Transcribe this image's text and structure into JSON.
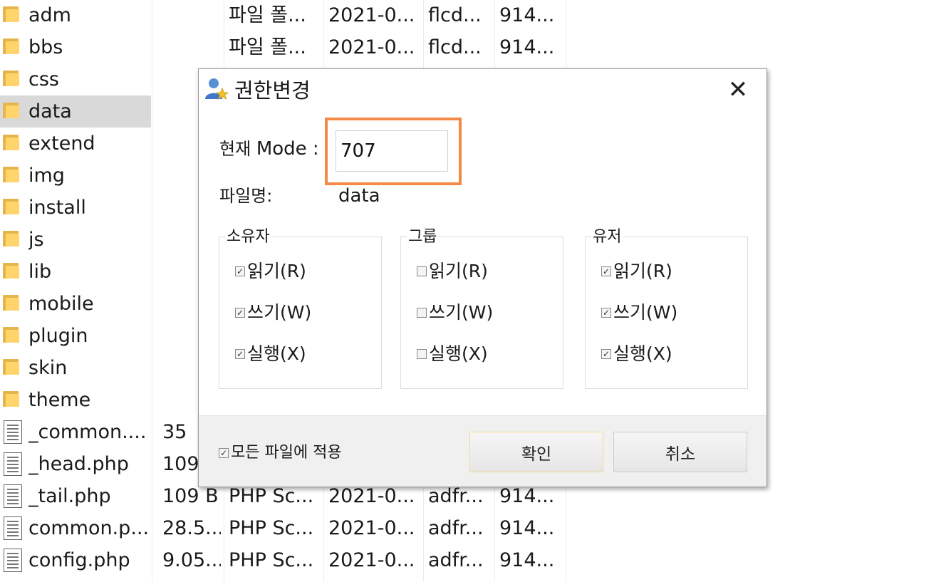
{
  "files": [
    {
      "kind": "folder",
      "name": "adm",
      "size": "",
      "type": "파일 폴...",
      "date": "2021-0...",
      "owner": "flcd...",
      "perm": "914..."
    },
    {
      "kind": "folder",
      "name": "bbs",
      "size": "",
      "type": "파일 폴...",
      "date": "2021-0...",
      "owner": "flcd...",
      "perm": "914..."
    },
    {
      "kind": "folder",
      "name": "css",
      "size": "",
      "type": "",
      "date": "",
      "owner": "",
      "perm": ""
    },
    {
      "kind": "folder",
      "name": "data",
      "size": "",
      "type": "",
      "date": "",
      "owner": "",
      "perm": "",
      "selected": true
    },
    {
      "kind": "folder",
      "name": "extend",
      "size": "",
      "type": "",
      "date": "",
      "owner": "",
      "perm": ""
    },
    {
      "kind": "folder",
      "name": "img",
      "size": "",
      "type": "",
      "date": "",
      "owner": "",
      "perm": ""
    },
    {
      "kind": "folder",
      "name": "install",
      "size": "",
      "type": "",
      "date": "",
      "owner": "",
      "perm": ""
    },
    {
      "kind": "folder",
      "name": "js",
      "size": "",
      "type": "",
      "date": "",
      "owner": "",
      "perm": ""
    },
    {
      "kind": "folder",
      "name": "lib",
      "size": "",
      "type": "",
      "date": "",
      "owner": "",
      "perm": ""
    },
    {
      "kind": "folder",
      "name": "mobile",
      "size": "",
      "type": "",
      "date": "",
      "owner": "",
      "perm": ""
    },
    {
      "kind": "folder",
      "name": "plugin",
      "size": "",
      "type": "",
      "date": "",
      "owner": "",
      "perm": ""
    },
    {
      "kind": "folder",
      "name": "skin",
      "size": "",
      "type": "",
      "date": "",
      "owner": "",
      "perm": ""
    },
    {
      "kind": "folder",
      "name": "theme",
      "size": "",
      "type": "",
      "date": "",
      "owner": "",
      "perm": ""
    },
    {
      "kind": "file",
      "name": "_common....",
      "size": "35",
      "type": "",
      "date": "",
      "owner": "",
      "perm": ""
    },
    {
      "kind": "file",
      "name": "_head.php",
      "size": "109",
      "type": "",
      "date": "",
      "owner": "",
      "perm": ""
    },
    {
      "kind": "file",
      "name": "_tail.php",
      "size": "109 B",
      "type": "PHP Sc...",
      "date": "2021-0...",
      "owner": "adfr...",
      "perm": "914..."
    },
    {
      "kind": "file",
      "name": "common.p...",
      "size": "28.5...",
      "type": "PHP Sc...",
      "date": "2021-0...",
      "owner": "adfr...",
      "perm": "914..."
    },
    {
      "kind": "file",
      "name": "config.php",
      "size": "9.05...",
      "type": "PHP Sc...",
      "date": "2021-0...",
      "owner": "adfr...",
      "perm": "914..."
    }
  ],
  "dialog": {
    "title": "권한변경",
    "close_label": "✕",
    "mode_label": "현재",
    "mode_label_en": "Mode :",
    "mode_value": "707",
    "filename_label": "파일명:",
    "filename_value": "data",
    "groups": [
      {
        "title": "소유자",
        "read": "읽기(R)",
        "write": "쓰기(W)",
        "exec": "실행(X)",
        "read_checked": true,
        "write_checked": true,
        "exec_checked": true
      },
      {
        "title": "그룹",
        "read": "읽기(R)",
        "write": "쓰기(W)",
        "exec": "실행(X)",
        "read_checked": false,
        "write_checked": false,
        "exec_checked": false
      },
      {
        "title": "유저",
        "read": "읽기(R)",
        "write": "쓰기(W)",
        "exec": "실행(X)",
        "read_checked": true,
        "write_checked": true,
        "exec_checked": true
      }
    ],
    "apply_all_label": "모든 파일에 적용",
    "apply_all_checked": true,
    "ok_label": "확인",
    "cancel_label": "취소"
  },
  "colors": {
    "highlight": "#f28b47",
    "selected_row": "#d9d9d9",
    "folder": "#ffd46a"
  }
}
